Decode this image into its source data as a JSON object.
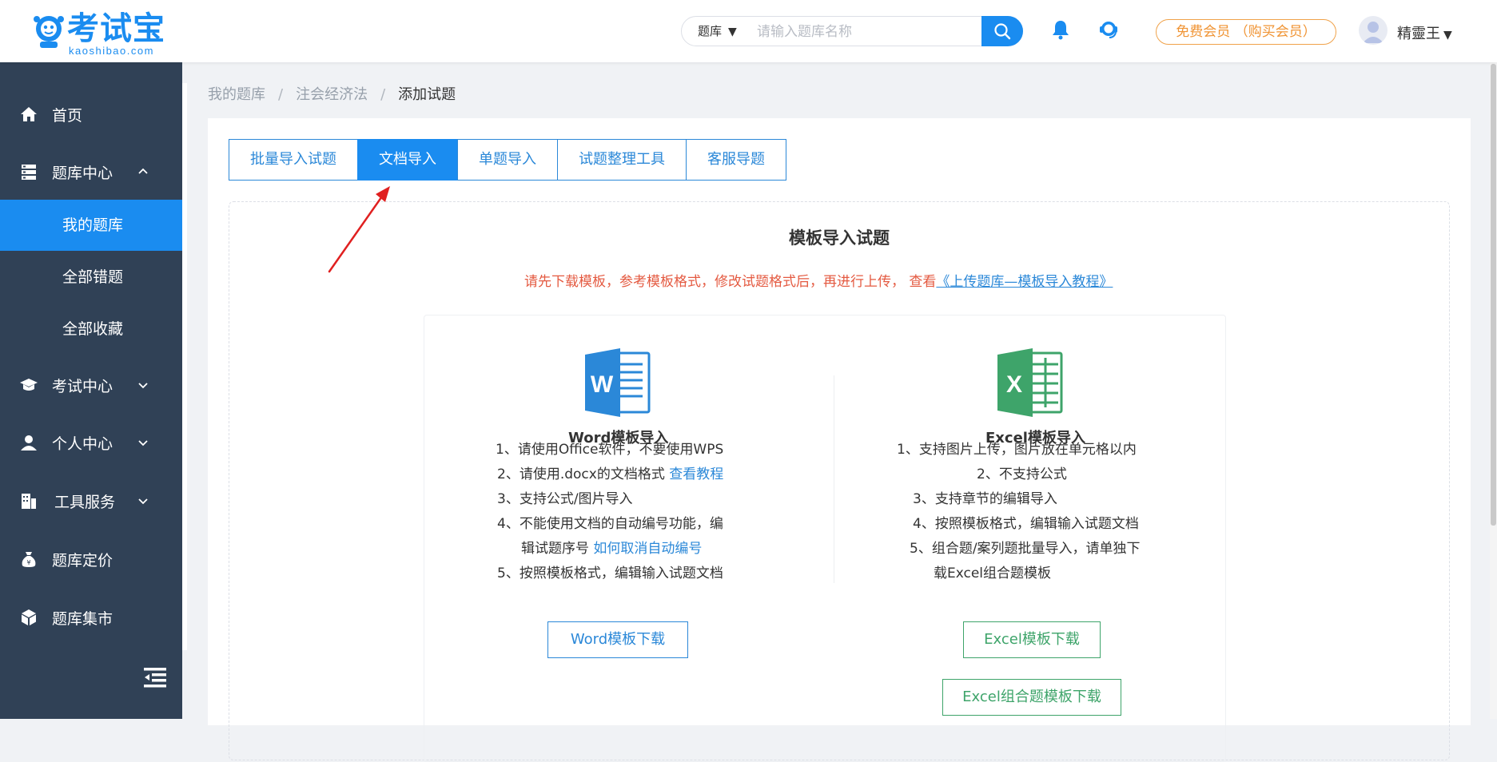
{
  "header": {
    "logo_text": "考试宝",
    "logo_sub": "kaoshibao.com",
    "search": {
      "type_label": "题库",
      "placeholder": "请输入题库名称"
    },
    "vip_label": "免费会员 （购买会员）",
    "username": "精靈王"
  },
  "sidebar": {
    "home": "首页",
    "bank_center": "题库中心",
    "my_bank": "我的题库",
    "all_wrong": "全部错题",
    "all_favorites": "全部收藏",
    "exam_center": "考试中心",
    "personal_center": "个人中心",
    "tools": "工具服务",
    "pricing": "题库定价",
    "market": "题库集市"
  },
  "breadcrumb": {
    "items": [
      "我的题库",
      "注会经济法",
      "添加试题"
    ],
    "separator": "/"
  },
  "tabs": [
    "批量导入试题",
    "文档导入",
    "单题导入",
    "试题整理工具",
    "客服导题"
  ],
  "main": {
    "title": "模板导入试题",
    "notice_text": "请先下载模板，参考模板格式，修改试题格式后，再进行上传，  查看",
    "notice_link": "《上传题库—模板导入教程》"
  },
  "word": {
    "title": "Word模板导入",
    "rule1": "1、请使用Office软件，不要使用WPS",
    "rule2": "2、请使用.docx的文档格式",
    "rule2_link": "查看教程",
    "rule3": "3、支持公式/图片导入",
    "rule4a": "4、不能使用文档的自动编号功能，编",
    "rule4b": "辑试题序号",
    "rule4_link": "如何取消自动编号",
    "rule5": "5、按照模板格式，编辑输入试题文档",
    "download": "Word模板下载"
  },
  "excel": {
    "title": "Excel模板导入",
    "rule1": "1、支持图片上传，图片放在单元格以内",
    "rule2": "2、不支持公式",
    "rule3": "3、支持章节的编辑导入",
    "rule4": "4、按照模板格式，编辑输入试题文档",
    "rule5a": "5、组合题/案列题批量导入，请单独下",
    "rule5b": "载Excel组合题模板",
    "download": "Excel模板下载",
    "combo_download": "Excel组合题模板下载"
  },
  "colors": {
    "primary": "#1a8cf0",
    "sidebar_bg": "#304156",
    "notice": "#e45a41",
    "excel_green": "#3ea46a",
    "vip_orange": "#f09434"
  }
}
